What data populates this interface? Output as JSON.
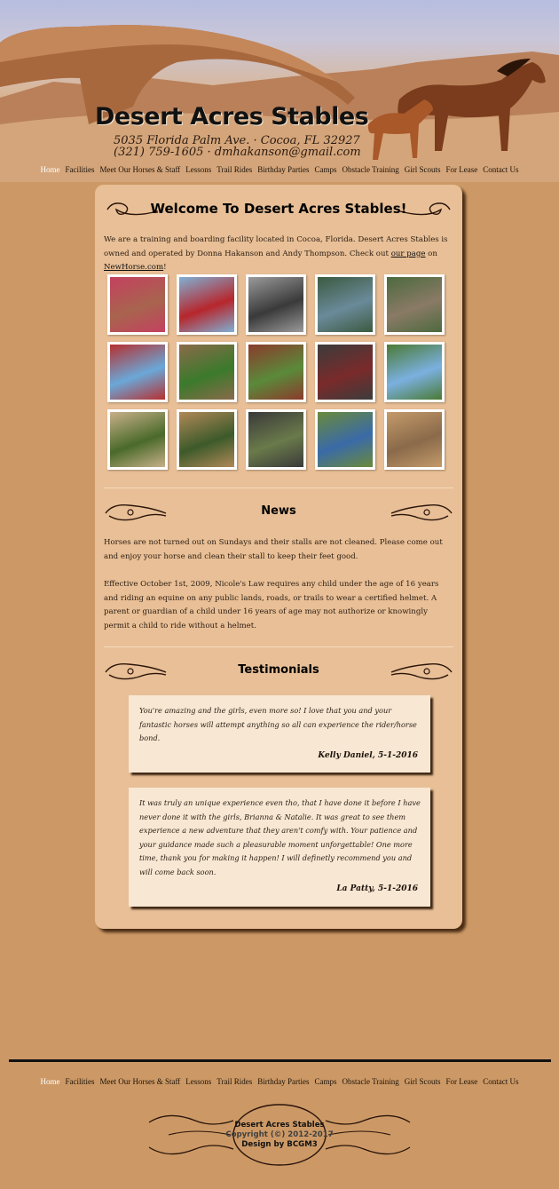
{
  "header": {
    "title": "Desert Acres Stables",
    "address_line": "5035 Florida Palm Ave. · Cocoa, FL 32927",
    "contact_line": "(321) 759-1605 · dmhakanson@gmail.com"
  },
  "nav": {
    "items": [
      "Home",
      "Facilities",
      "Meet Our Horses & Staff",
      "Lessons",
      "Trail Rides",
      "Birthday Parties",
      "Camps",
      "Obstacle Training",
      "Girl Scouts",
      "For Lease",
      "Contact Us"
    ],
    "active": "Home"
  },
  "welcome": {
    "title": "Welcome To Desert Acres Stables!",
    "intro_before": "We are a training and boarding facility located in Cocoa, Florida. Desert Acres Stables is owned and operated by Donna Hakanson and Andy Thompson. Check out ",
    "link1": "our page",
    "intro_middle": " on ",
    "link2": "NewHorse.com",
    "intro_after": "!"
  },
  "gallery": {
    "colors": [
      [
        "#a8644e",
        "#c44060"
      ],
      [
        "#b7262c",
        "#7fb0d4"
      ],
      [
        "#3a3a3a",
        "#9a9a9a"
      ],
      [
        "#6a8a9a",
        "#3c5a40"
      ],
      [
        "#8a7a66",
        "#4c6a3e"
      ],
      [
        "#6aa8d8",
        "#b63030"
      ],
      [
        "#3b7a2c",
        "#8a6a4a"
      ],
      [
        "#5a8a3a",
        "#8b3b2c"
      ],
      [
        "#7a2a2a",
        "#3c3c3c"
      ],
      [
        "#7bb0e0",
        "#4a7a34"
      ],
      [
        "#4a6a2a",
        "#c8b08a"
      ],
      [
        "#3d5a2a",
        "#b08858"
      ],
      [
        "#6a7a4a",
        "#3a3a3a"
      ],
      [
        "#3a6aa8",
        "#6a8a3a"
      ],
      [
        "#8a6a4a",
        "#c49a6a"
      ]
    ]
  },
  "news": {
    "title": "News",
    "paragraphs": [
      "Horses are not turned out on Sundays and their stalls are not cleaned. Please come out and enjoy your horse and clean their stall to keep their feet good.",
      "Effective October 1st, 2009, Nicole's Law requires any child under the age of 16 years and riding an equine on any public lands, roads, or trails to wear a certified helmet. A parent or guardian of a child under 16 years of age may not authorize or knowingly permit a child to ride without a helmet."
    ]
  },
  "testimonials": {
    "title": "Testimonials",
    "items": [
      {
        "text": "You're amazing and the girls, even more so! I love that you and your fantastic horses will attempt anything so all can experience the rider/horse bond.",
        "author": "Kelly Daniel, 5-1-2016"
      },
      {
        "text": "It was truly an unique experience even tho, that I have done it before I have never done it with the girls, Brianna & Natalie. It was great to see them experience a new adventure that they aren't comfy with. Your patience and your guidance made such a pleasurable moment unforgettable! One more time, thank you for making it happen! I will definetly recommend you and will come back soon.",
        "author": "La Patty, 5-1-2016"
      }
    ]
  },
  "footer": {
    "name": "Desert Acres Stables",
    "copyright": "Copyright (©) 2012-2017",
    "design": "Design by BCGM3"
  }
}
